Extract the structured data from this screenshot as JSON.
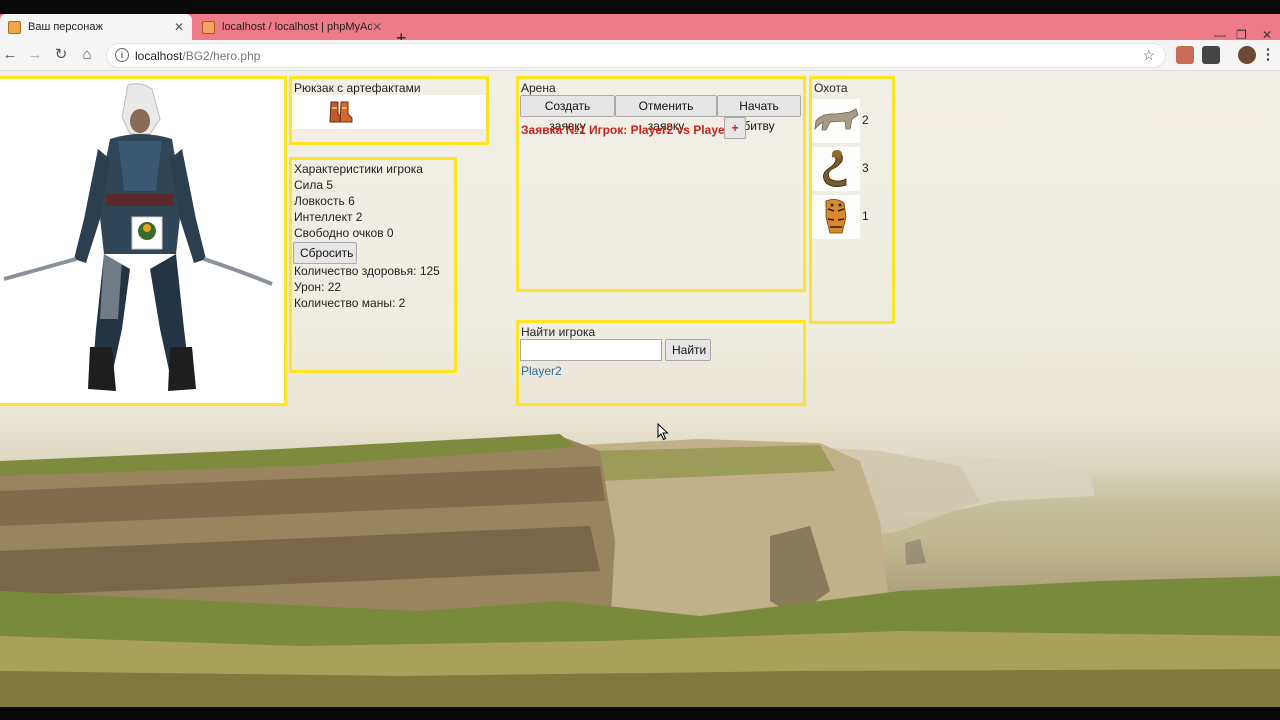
{
  "browser": {
    "tabs": [
      {
        "title": "Ваш персонаж",
        "active": true
      },
      {
        "title": "localhost / localhost | phpMyAdmin",
        "active": false
      }
    ],
    "url_host": "localhost",
    "url_path": "/BG2/hero.php",
    "colors": {
      "tabstrip": "#ee7b88",
      "toolbar": "#f5f5f5"
    }
  },
  "backpack": {
    "title": "Рюкзак с артефактами",
    "items": [
      {
        "icon": "boots-icon"
      }
    ]
  },
  "stats": {
    "title": "Характеристики игрока",
    "strength": "Сила 5",
    "agility": "Ловкость 6",
    "intellect": "Интеллект 2",
    "free_points": "Свободно очков 0",
    "reset_label": "Сбросить",
    "health": "Количество здоровья: 125",
    "damage": "Урон: 22",
    "mana": "Количество маны: 2"
  },
  "arena": {
    "title": "Арена",
    "create_label": "Создать заявку",
    "cancel_label": "Отменить заявку",
    "start_label": "Начать битву",
    "request_text": "Заявка №1 Игрок: Player2 vs Player1",
    "join_label": "+"
  },
  "find": {
    "title": "Найти игрока",
    "input_value": "",
    "button_label": "Найти",
    "result": "Player2"
  },
  "hunt": {
    "title": "Охота",
    "animals": [
      {
        "icon": "wolf-icon",
        "count": "2"
      },
      {
        "icon": "cobra-icon",
        "count": "3"
      },
      {
        "icon": "tiger-icon",
        "count": "1"
      }
    ]
  },
  "accent_colors": {
    "panel_border": "#fde525",
    "request_text": "#c8241c",
    "link": "#2c6aa0"
  }
}
